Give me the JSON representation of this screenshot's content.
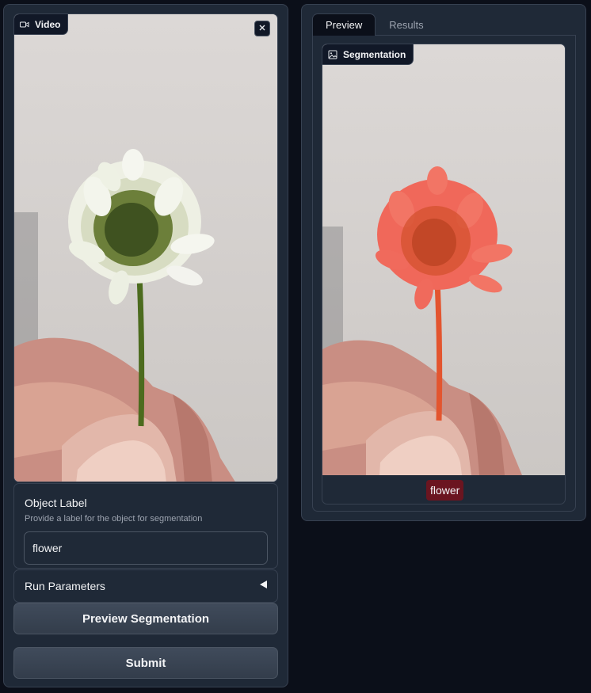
{
  "video_block": {
    "label": "Video",
    "label_icon": "video-camera-icon",
    "close_icon": "close-icon"
  },
  "object_label": {
    "title": "Object Label",
    "info": "Provide a label for the object for segmentation",
    "value": "flower"
  },
  "run_parameters": {
    "label": "Run Parameters",
    "toggle_icon": "triangle-left-icon"
  },
  "buttons": {
    "preview": "Preview Segmentation",
    "submit": "Submit"
  },
  "tabs": [
    {
      "label": "Preview",
      "active": true
    },
    {
      "label": "Results",
      "active": false
    }
  ],
  "segmentation_block": {
    "label": "Segmentation",
    "label_icon": "image-icon",
    "chips": [
      "flower"
    ]
  },
  "colors": {
    "background": "#0b0f19",
    "panel": "#1f2937",
    "border": "#374151",
    "mask": "#f0685a",
    "chip": "#6b1520"
  }
}
